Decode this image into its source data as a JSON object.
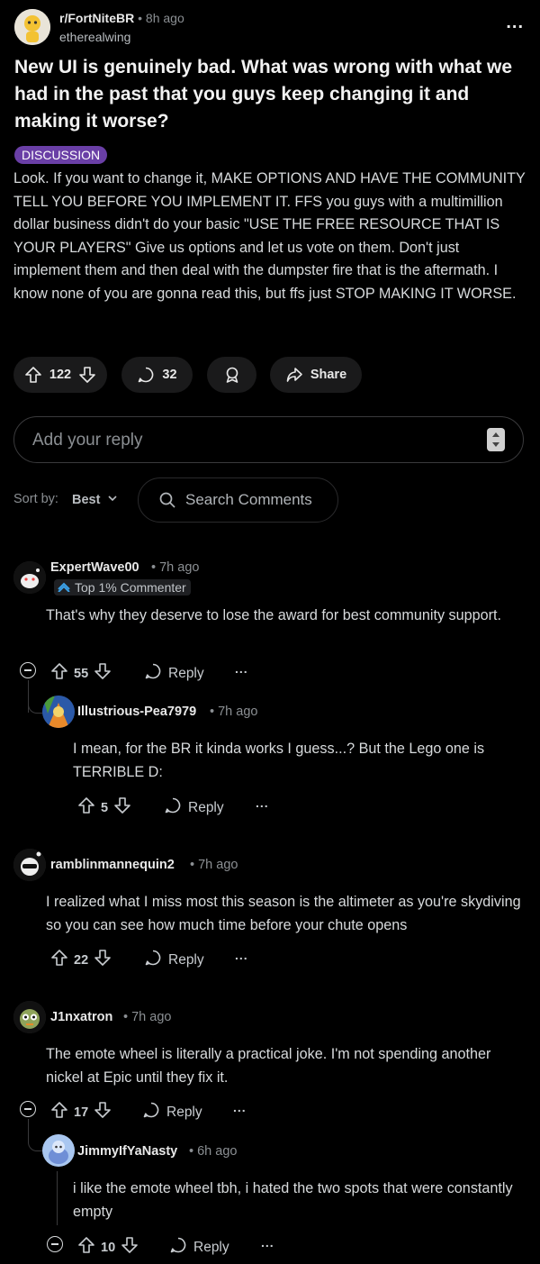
{
  "post": {
    "subreddit": "r/FortNiteBR",
    "time": "8h ago",
    "author": "etherealwing",
    "title": "New UI is genuinely bad. What was wrong with what we had in the past that you guys keep changing it and making it worse?",
    "flair": "DISCUSSION",
    "body": "Look. If you want to change it, MAKE OPTIONS AND HAVE THE COMMUNITY TELL YOU BEFORE YOU IMPLEMENT IT. FFS you guys with a multimillion dollar business didn't do your basic \"USE THE FREE RESOURCE THAT IS YOUR PLAYERS\" Give us options and let us vote on them. Don't just implement them and then deal with the dumpster fire that is the aftermath. I know none of you are gonna read this, but ffs just STOP MAKING IT WORSE.",
    "votes": "122",
    "comments": "32",
    "share_label": "Share",
    "more_label": "..."
  },
  "reply_box": {
    "placeholder": "Add your reply"
  },
  "sort": {
    "label": "Sort by:",
    "value": "Best",
    "search_placeholder": "Search Comments"
  },
  "comments": [
    {
      "author": "ExpertWave00",
      "time": "7h ago",
      "badge": "Top 1% Commenter",
      "text": "That's why they deserve to lose the award for best community support.",
      "votes": "55",
      "reply": "Reply",
      "more": "..."
    },
    {
      "author": "Illustrious-Pea7979",
      "time": "7h ago",
      "text": "I mean, for the BR it kinda works I guess...? But the Lego one is TERRIBLE D:",
      "votes": "5",
      "reply": "Reply",
      "more": "..."
    },
    {
      "author": "ramblinmannequin2",
      "time": "7h ago",
      "text": "I realized what I miss most this season is the altimeter as you're skydiving so you can see how much time before your chute opens",
      "votes": "22",
      "reply": "Reply",
      "more": "..."
    },
    {
      "author": "J1nxatron",
      "time": "7h ago",
      "text": "The emote wheel is literally a practical joke. I'm not spending another nickel at Epic until they fix it.",
      "votes": "17",
      "reply": "Reply",
      "more": "..."
    },
    {
      "author": "JimmyIfYaNasty",
      "time": "6h ago",
      "text": "i like the emote wheel tbh, i hated the two spots that were constantly empty",
      "votes": "10",
      "reply": "Reply",
      "more": "..."
    }
  ]
}
